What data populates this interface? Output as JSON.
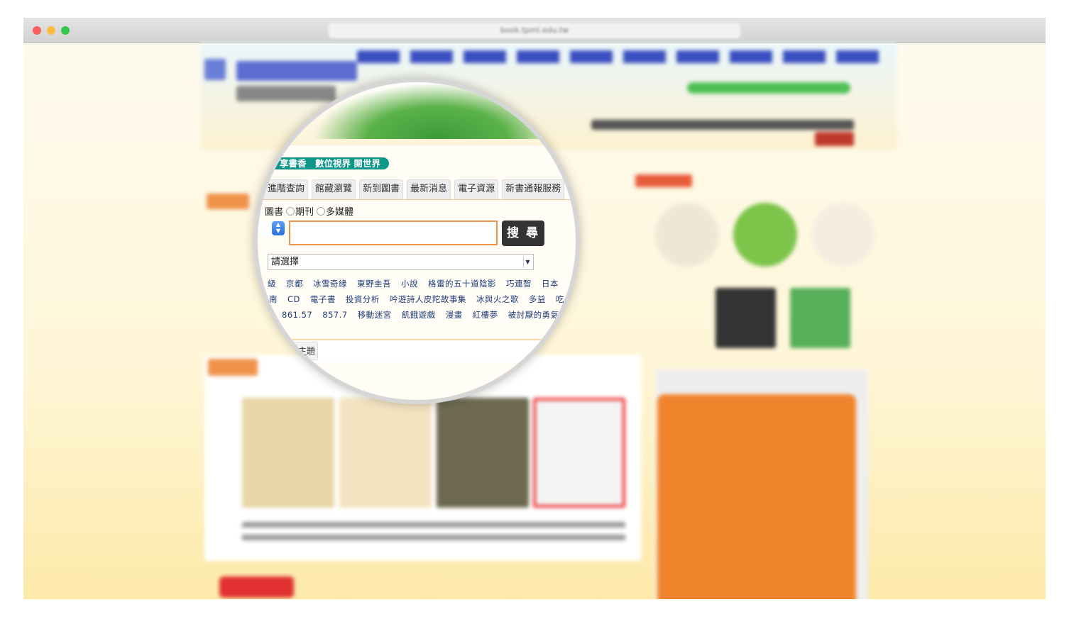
{
  "browser": {
    "url": "book.tpml.edu.tw"
  },
  "slogan": "享書香　數位視界 閱世界",
  "tabs": [
    "進階查詢",
    "館藏瀏覽",
    "新到圖書",
    "最新消息",
    "電子資源",
    "新書通報服務"
  ],
  "search_types": [
    "圖書",
    "期刊",
    "多媒體"
  ],
  "search_button": "搜 尋",
  "dropdown_selected": "請選擇",
  "hot_keywords": [
    [
      "級",
      "京都",
      "冰雪奇緣",
      "東野圭吾",
      "小說",
      "格雷的五十道陰影",
      "巧連智",
      "日本"
    ],
    [
      "南",
      "CD",
      "電子書",
      "投資分析",
      "吟遊詩人皮陀故事集",
      "冰與火之歌",
      "多益",
      "吃"
    ],
    [
      "861.57",
      "857.7",
      "移動迷宮",
      "飢餓遊戲",
      "漫畫",
      "紅樓夢",
      "被討厭的勇氣"
    ]
  ],
  "subtab_suffix": "主題",
  "colors": {
    "accent": "#f0924a",
    "teal": "#0e9688",
    "button": "#333333"
  }
}
